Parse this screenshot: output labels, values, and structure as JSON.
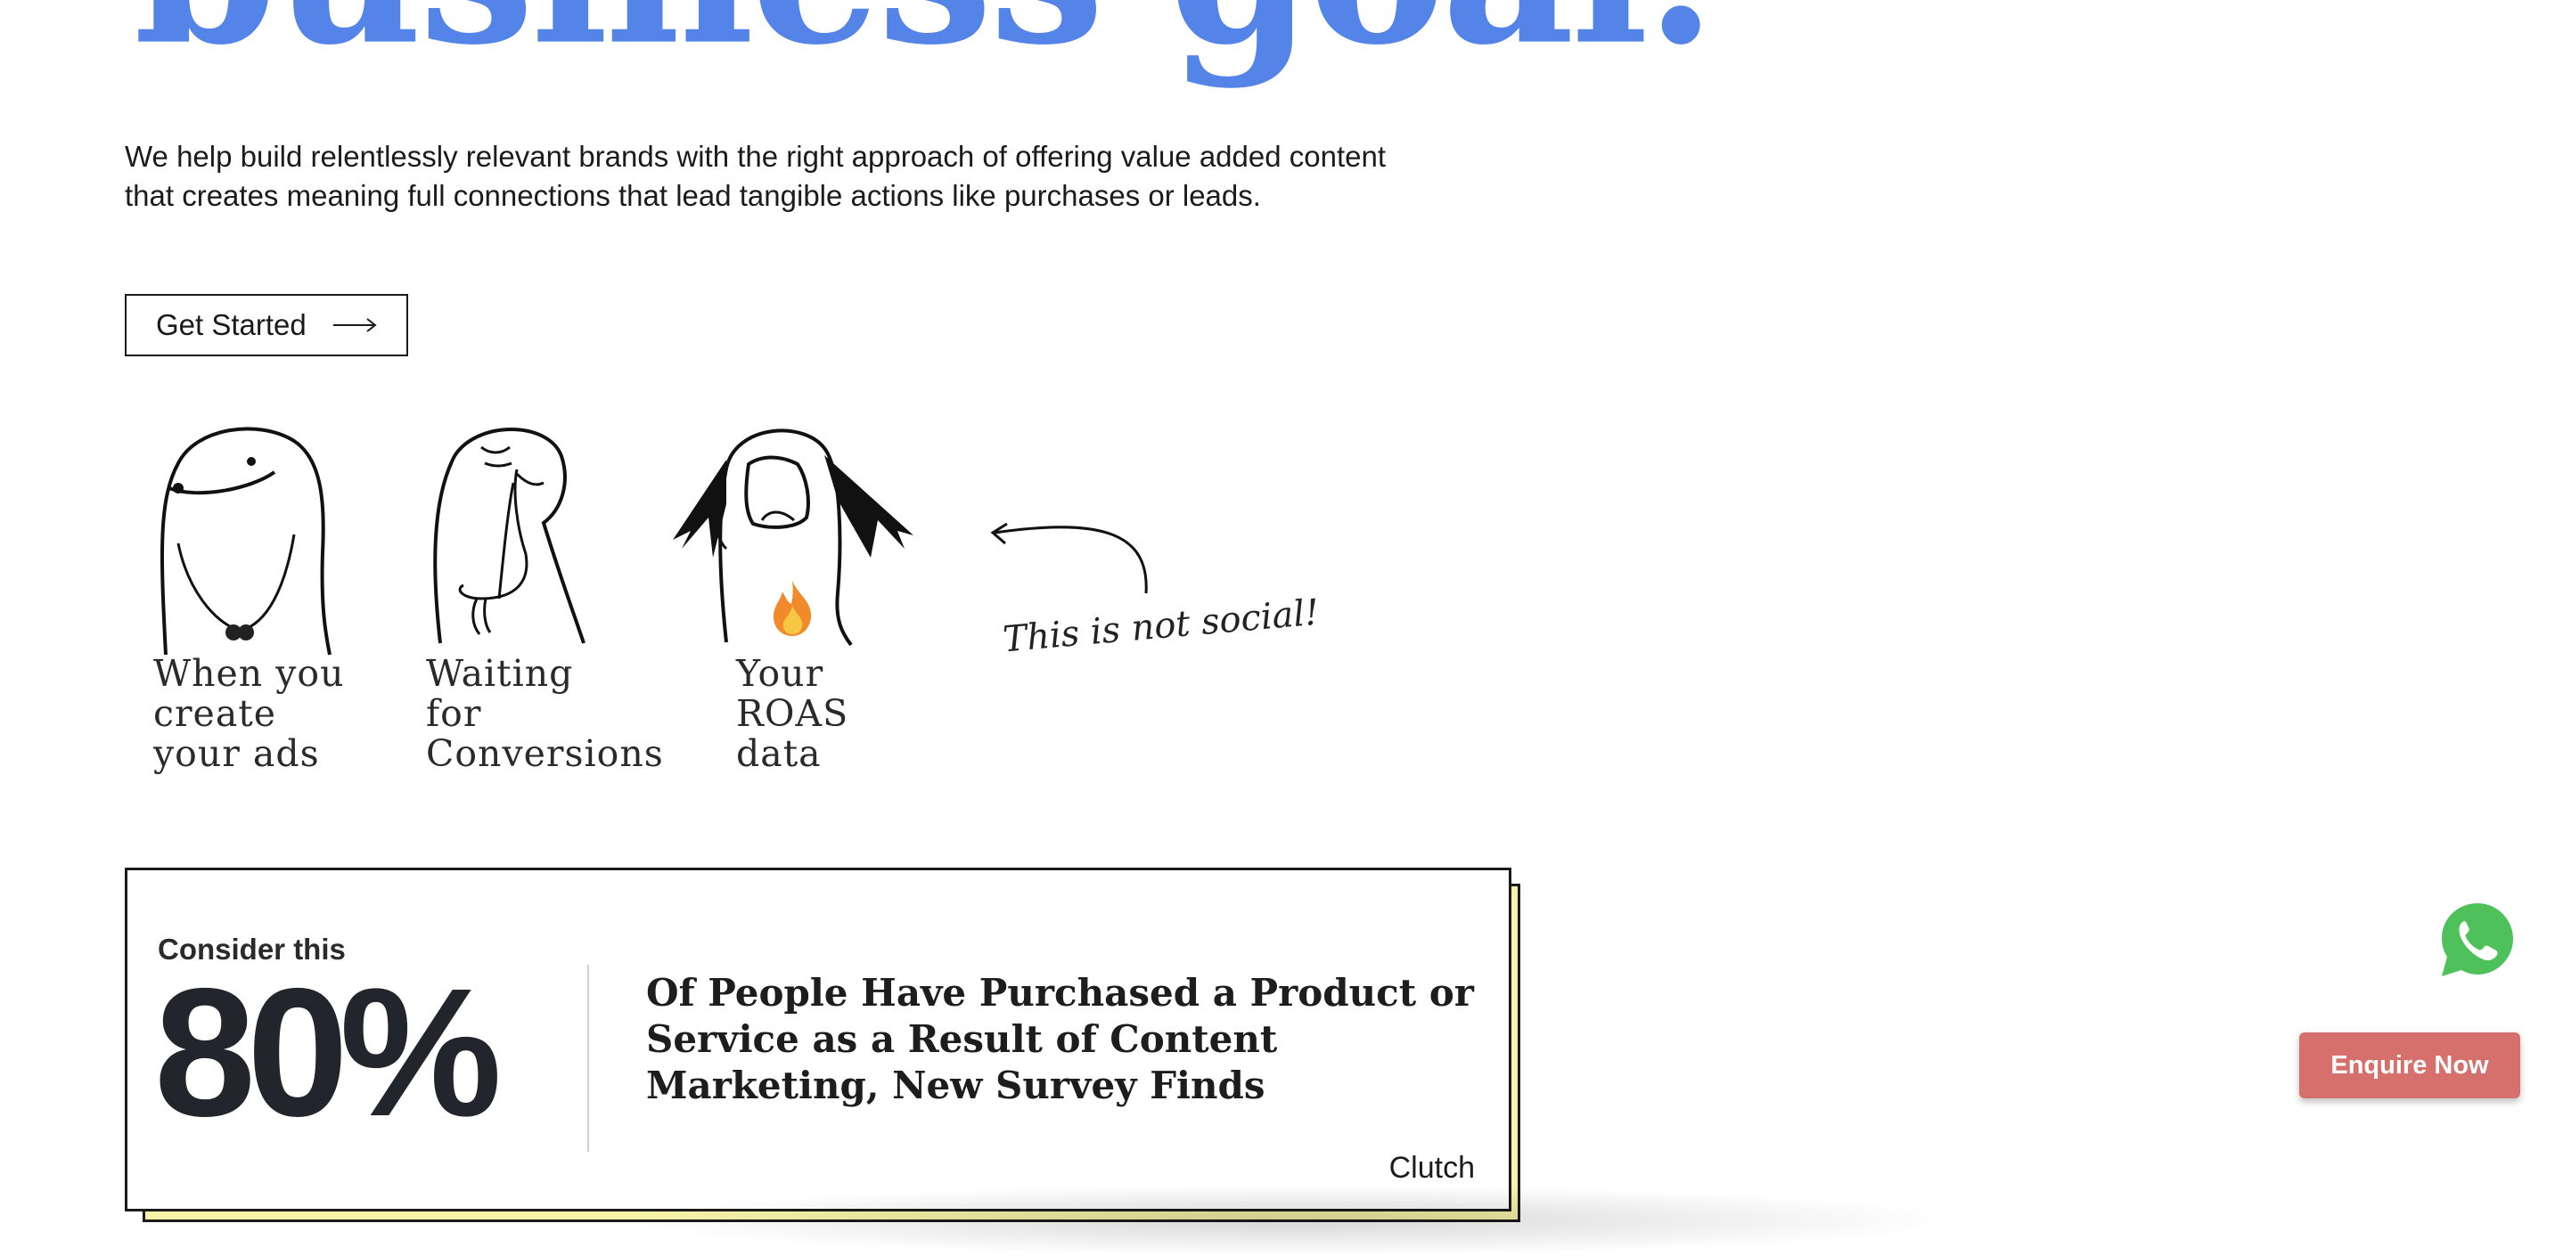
{
  "hero": {
    "title": "business goal."
  },
  "intro": {
    "text": "We help build relentlessly relevant brands with the right approach of offering value added content that creates meaning full connections that lead tangible actions like purchases or leads."
  },
  "cta": {
    "label": "Get Started",
    "icon": "arrow-right-icon"
  },
  "memes": {
    "items": [
      {
        "caption": "When you\ncreate\nyour ads"
      },
      {
        "caption": "Waiting\nfor\nConversions"
      },
      {
        "caption": "Your\nROAS\ndata"
      }
    ],
    "annotation": "This is not social!"
  },
  "stat_card": {
    "kicker": "Consider this",
    "stat": "80%",
    "headline": "Of People Have Purchased a Product or Service as a Result of Content Marketing, New Survey Finds",
    "source": "Clutch",
    "shadow_color": "#f6f3a8"
  },
  "floating": {
    "whatsapp_icon": "whatsapp-icon",
    "whatsapp_color": "#4fc15a",
    "enquire_label": "Enquire Now",
    "enquire_color": "#d6706c"
  }
}
